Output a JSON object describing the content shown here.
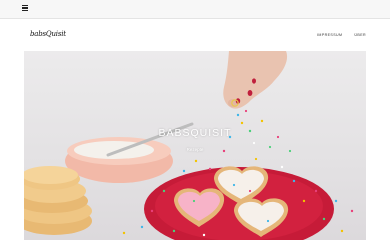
{
  "topbar": {
    "menu_icon": "hamburger-menu-icon"
  },
  "header": {
    "logo": "babsQuisit",
    "nav": [
      {
        "label": "IMPRESSUM"
      },
      {
        "label": "ÜBER"
      }
    ]
  },
  "hero": {
    "title": "BABSQUISIT",
    "subtitle": "Rezepte",
    "colors": {
      "plate": "#d2213f",
      "bowl": "#f2b9a8",
      "icing": "#f7b3c8",
      "background": "#e6e4e6"
    }
  }
}
